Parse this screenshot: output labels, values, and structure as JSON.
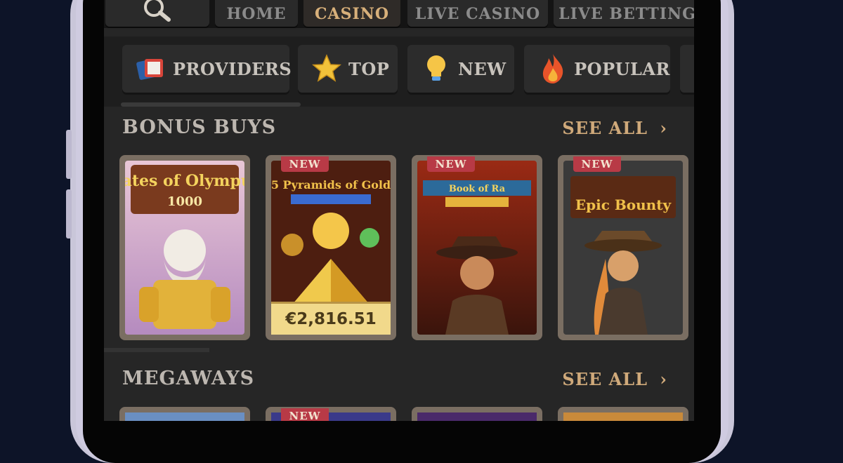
{
  "nav": {
    "items": [
      {
        "label": "HOME"
      },
      {
        "label": "CASINO",
        "active": true
      },
      {
        "label": "LIVE CASINO"
      },
      {
        "label": "LIVE BETTING"
      }
    ]
  },
  "categories": [
    {
      "label": "PROVIDERS",
      "icon": "providers-icon"
    },
    {
      "label": "TOP",
      "icon": "star-icon"
    },
    {
      "label": "NEW",
      "icon": "lightbulb-icon"
    },
    {
      "label": "POPULAR",
      "icon": "fire-icon"
    }
  ],
  "sections": [
    {
      "title": "BONUS BUYS",
      "see_all": "SEE ALL",
      "games": [
        {
          "name": "Gates of Olympus",
          "subtitle": "1000",
          "badge": ""
        },
        {
          "name": "5 Pyramids of Gold",
          "badge": "NEW",
          "jackpot": "€2,816.51"
        },
        {
          "name": "Book of Ra",
          "badge": "NEW"
        },
        {
          "name": "Epic Bounty",
          "badge": "NEW"
        }
      ]
    },
    {
      "title": "MEGAWAYS",
      "see_all": "SEE ALL",
      "games": [
        {
          "badge": ""
        },
        {
          "badge": "NEW"
        },
        {
          "badge": ""
        },
        {
          "badge": ""
        }
      ]
    }
  ],
  "colors": {
    "background": "#0d1428",
    "screen": "#262626",
    "accent": "#cfa97a",
    "badge": "#b83a46",
    "jackpot": "#f1d98b"
  }
}
